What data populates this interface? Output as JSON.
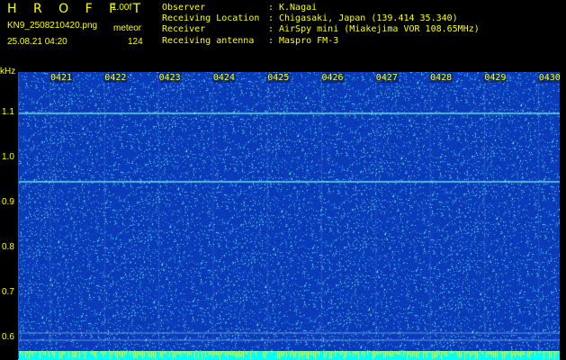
{
  "header": {
    "logo": "H R O F F T",
    "version": "1.00f",
    "filename": "KN9_2508210420.png",
    "mode": "meteor",
    "datetime": "25.08.21 04:20",
    "count": "124"
  },
  "station": [
    {
      "label": "Observer",
      "value": "K.Nagai"
    },
    {
      "label": "Receiving Location",
      "value": "Chigasaki, Japan (139.414 35.340)"
    },
    {
      "label": "Receiver",
      "value": "AirSpy mini (Miakejima VOR 108.65MHz)"
    },
    {
      "label": "Receiving antenna",
      "value": "Maspro FM-3"
    }
  ],
  "axis": {
    "unit": "kHz",
    "y_ticks": [
      "1.1",
      "1.0",
      "0.9",
      "0.8",
      "0.7",
      "0.6"
    ],
    "time_ticks": [
      "0421",
      "0422",
      "0423",
      "0424",
      "0425",
      "0426",
      "0427",
      "0428",
      "0429",
      "0430"
    ]
  },
  "colors": {
    "text": "#ffff00",
    "background": "#000000",
    "noise_floor": "#1028a8",
    "signal": "#80ffff"
  }
}
